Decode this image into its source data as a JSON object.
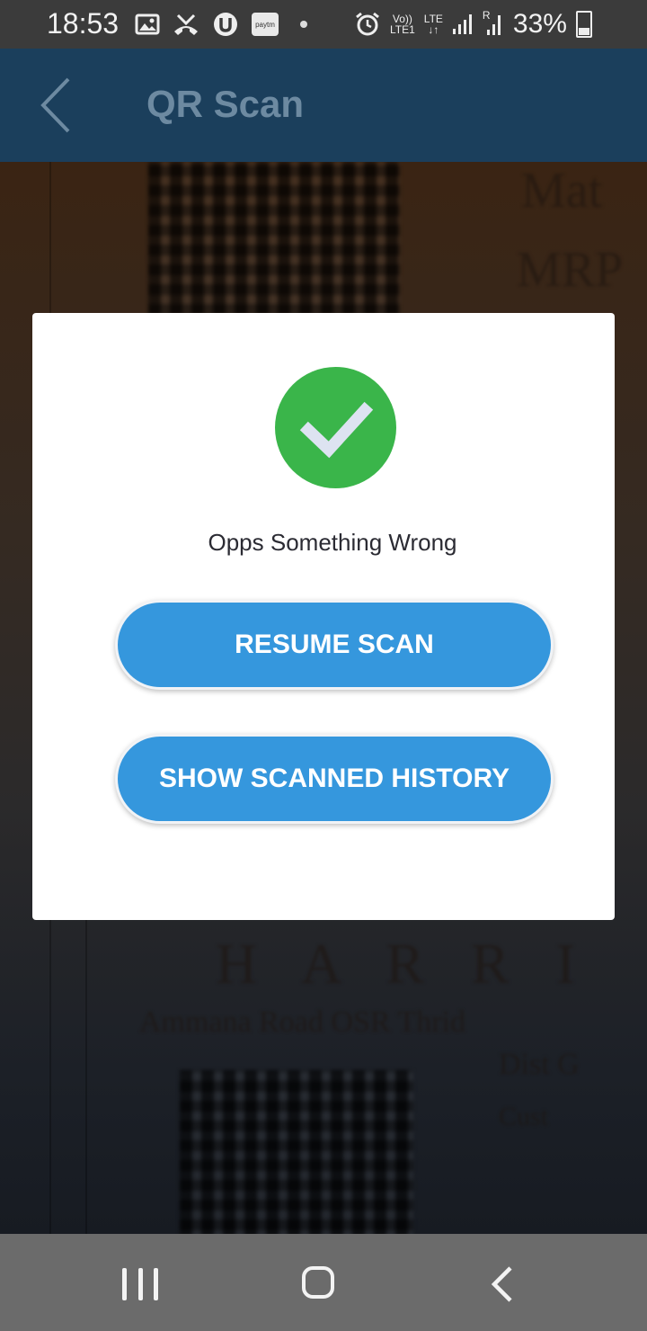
{
  "status_bar": {
    "time": "18:53",
    "battery_percent": "33%",
    "net_vo": "Vo))",
    "net_lte_top": "LTE",
    "net_lte1": "LTE1",
    "net_roaming": "R",
    "paytm_label": "paytm",
    "icons_left": [
      "gallery-icon",
      "missed-call-icon",
      "u-app-icon",
      "paytm-icon",
      "notification-dot-icon"
    ],
    "icons_right": [
      "alarm-icon",
      "volte-icon",
      "lte-icon",
      "signal-icon",
      "signal-roaming-icon",
      "battery-icon"
    ]
  },
  "app_bar": {
    "title": "QR Scan",
    "back_icon": "back-arrow-icon",
    "background_color": "#1b3f5c"
  },
  "background_text": {
    "top_right_1": "Mat",
    "top_right_2": "MRP",
    "mid_bottom": "H A R R I",
    "bottom_line": "Ammana Road OSR Thrid",
    "bottom_right": "Dist G",
    "bottom_right_2": "Cust"
  },
  "dialog": {
    "status_icon": "check-circle-icon",
    "status_color": "#3ab54a",
    "message": "Opps Something Wrong",
    "resume_button": "RESUME SCAN",
    "history_button": "SHOW SCANNED HISTORY",
    "button_color": "#3597dd"
  },
  "nav_bar": {
    "recents_icon": "recents-icon",
    "home_icon": "home-icon",
    "back_icon": "nav-back-icon"
  }
}
